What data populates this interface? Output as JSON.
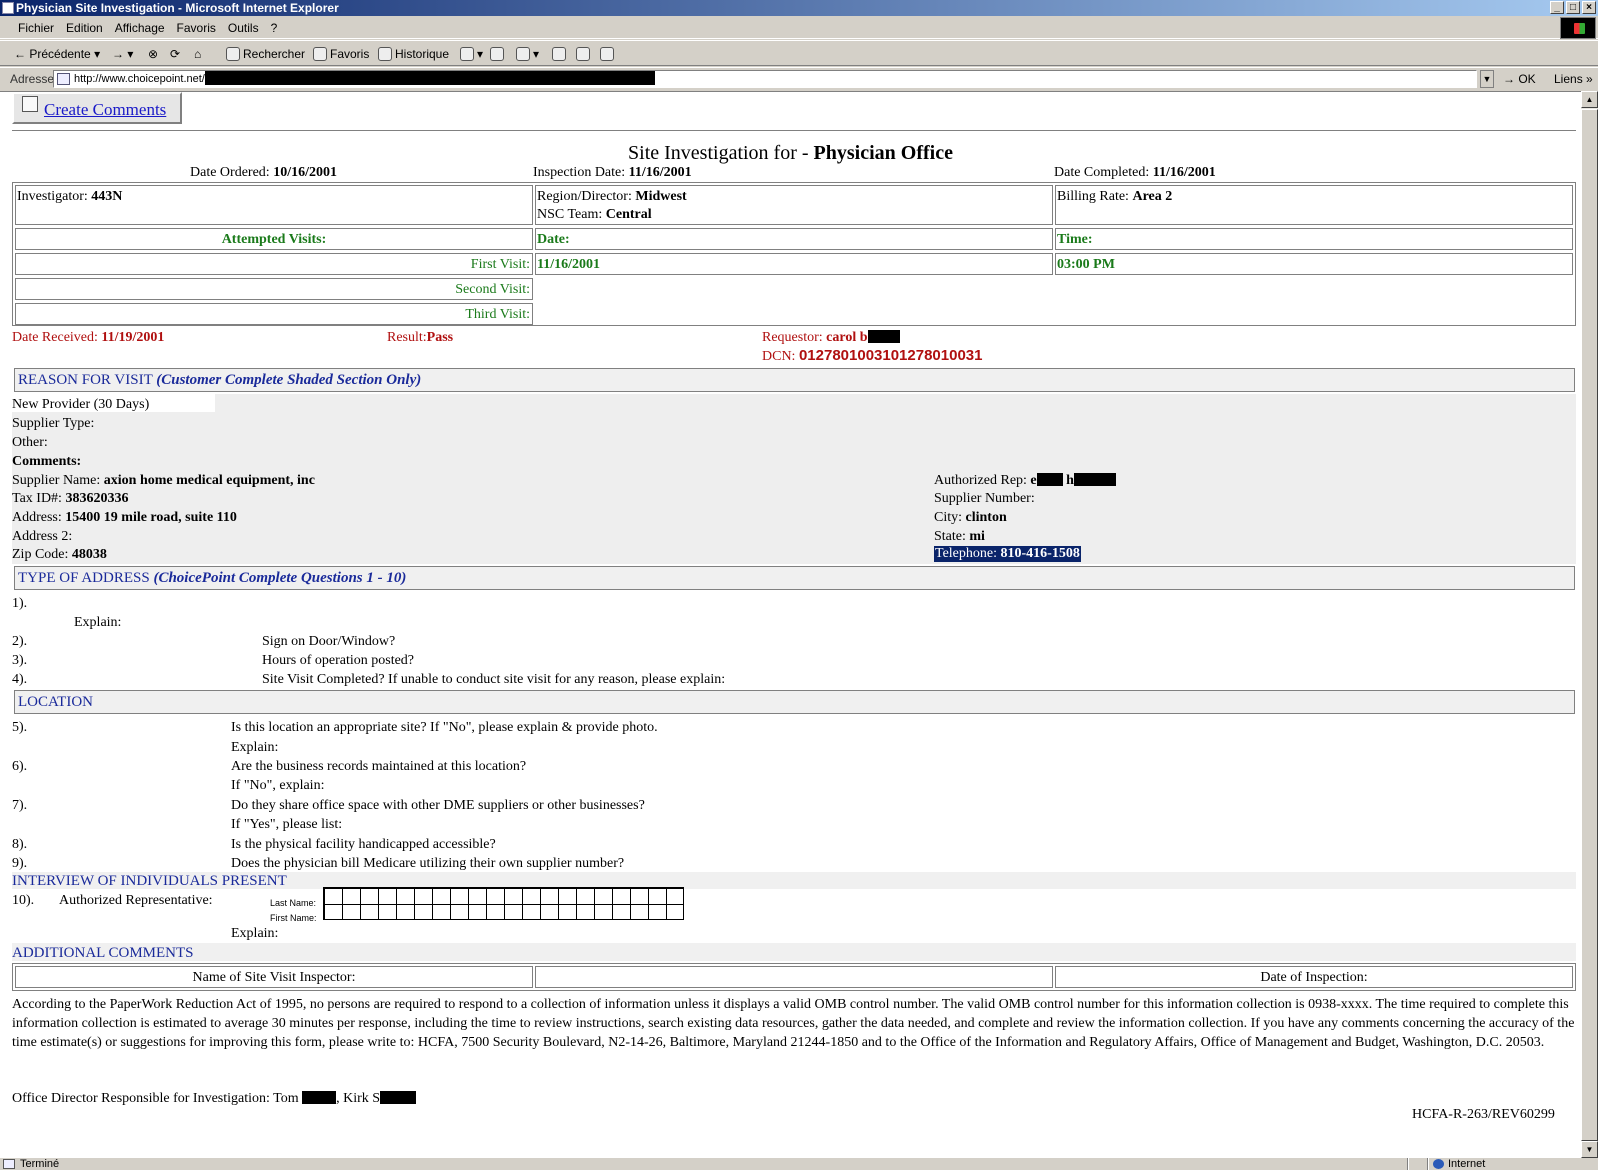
{
  "window": {
    "title": "Physician Site Investigation - Microsoft Internet Explorer"
  },
  "menu": [
    "Fichier",
    "Edition",
    "Affichage",
    "Favoris",
    "Outils",
    "?"
  ],
  "toolbar": {
    "back": "Précédente",
    "search": "Rechercher",
    "favorites": "Favoris",
    "history": "Historique"
  },
  "address": {
    "label": "Adresse",
    "url": "http://www.choicepoint.net/",
    "go": "OK",
    "links": "Liens"
  },
  "status": {
    "text": "Terminé",
    "zone": "Internet"
  },
  "page": {
    "create_comments": "Create Comments",
    "title_prefix": "Site Investigation for - ",
    "title_bold": "Physician Office",
    "date_ordered_label": "Date Ordered:",
    "date_ordered": "10/16/2001",
    "inspection_date_label": "Inspection Date:",
    "inspection_date": "11/16/2001",
    "date_completed_label": "Date Completed:",
    "date_completed": "11/16/2001",
    "investigator_label": "Investigator:",
    "investigator": "443N",
    "region_label": "Region/Director:",
    "region": "Midwest",
    "nsc_label": "NSC Team:",
    "nsc": "Central",
    "billing_label": "Billing Rate:",
    "billing": "Area 2",
    "attempted_label": "Attempted Visits:",
    "date_col": "Date:",
    "time_col": "Time:",
    "visits": [
      {
        "label": "First Visit:",
        "date": "11/16/2001",
        "time": "03:00 PM"
      },
      {
        "label": "Second Visit:",
        "date": "",
        "time": ""
      },
      {
        "label": "Third Visit:",
        "date": "",
        "time": ""
      }
    ],
    "date_received_label": "Date Received:",
    "date_received": "11/19/2001",
    "result_label": "Result:",
    "result": "Pass",
    "requestor_label": "Requestor:",
    "requestor": "carol b",
    "dcn_label": "DCN:",
    "dcn": "0127801003101278010031",
    "reason_head": "REASON FOR VISIT",
    "reason_sub": "(Customer Complete Shaded Section Only)",
    "new_provider": "New Provider (30 Days)",
    "supplier_type": "Supplier Type:",
    "other": "Other:",
    "comments": "Comments:",
    "supplier_name_label": "Supplier Name:",
    "supplier_name": "axion home medical equipment, inc",
    "tax_label": "Tax ID#:",
    "tax": "383620336",
    "address_label": "Address:",
    "address": "15400 19 mile road, suite 110",
    "address2_label": "Address 2:",
    "zip_label": "Zip Code:",
    "zip": "48038",
    "auth_rep_label": "Authorized Rep:",
    "auth_rep_a": "e",
    "auth_rep_b": "h",
    "supplier_number_label": "Supplier Number:",
    "city_label": "City:",
    "city": "clinton",
    "state_label": "State:",
    "state": "mi",
    "telephone_label": "Telephone:",
    "telephone": "810-416-1508",
    "type_head": "TYPE OF ADDRESS",
    "type_sub": "(ChoicePoint Complete Questions 1 - 10)",
    "q1": "1).",
    "explain": "Explain:",
    "q2": "2).",
    "q2_text": "Sign on Door/Window?",
    "q3": "3).",
    "q3_text": "Hours of operation posted?",
    "q4": "4).",
    "q4_text": "Site Visit Completed? If unable to conduct site visit for any reason, please explain:",
    "location_head": "LOCATION",
    "q5": "5).",
    "q5_text": "Is this location an appropriate site? If \"No\", please explain & provide photo.",
    "q6": "6).",
    "q6_text": "Are the business records maintained at this location?",
    "q6_sub": "If \"No\", explain:",
    "q7": "7).",
    "q7_text": "Do they share office space with other DME suppliers or other businesses?",
    "q7_sub": "If \"Yes\", please list:",
    "q8": "8).",
    "q8_text": "Is the physical facility handicapped accessible?",
    "q9": "9).",
    "q9_text": "Does the physician bill Medicare utilizing their own supplier number?",
    "interview_head": "INTERVIEW OF INDIVIDUALS PRESENT",
    "q10": "10).",
    "q10_text": "Authorized Representative:",
    "last_name": "Last Name:",
    "first_name": "First Name:",
    "additional_head": "ADDITIONAL COMMENTS",
    "inspector_label": "Name of Site Visit Inspector:",
    "date_insp_label": "Date of Inspection:",
    "paperwork": "According to the PaperWork Reduction Act of 1995, no persons are required to respond to a collection of information unless it displays a valid OMB control number. The valid OMB control number for this information collection is 0938-xxxx. The time required to complete this information collection is estimated to average 30 minutes per response, including the time to review instructions, search existing data resources, gather the data needed, and complete and review the information collection. If you have any comments concerning the accuracy of the time estimate(s) or suggestions for improving this form, please write to: HCFA, 7500 Security Boulevard, N2-14-26, Baltimore, Maryland 21244-1850 and to the Office of the Information and Regulatory Affairs, Office of Management and Budget, Washington, D.C. 20503.",
    "director_label": "Office Director Responsible for Investigation:",
    "director_a": "Tom",
    "director_b": ", Kirk S",
    "form_id": "HCFA-R-263/REV60299"
  }
}
